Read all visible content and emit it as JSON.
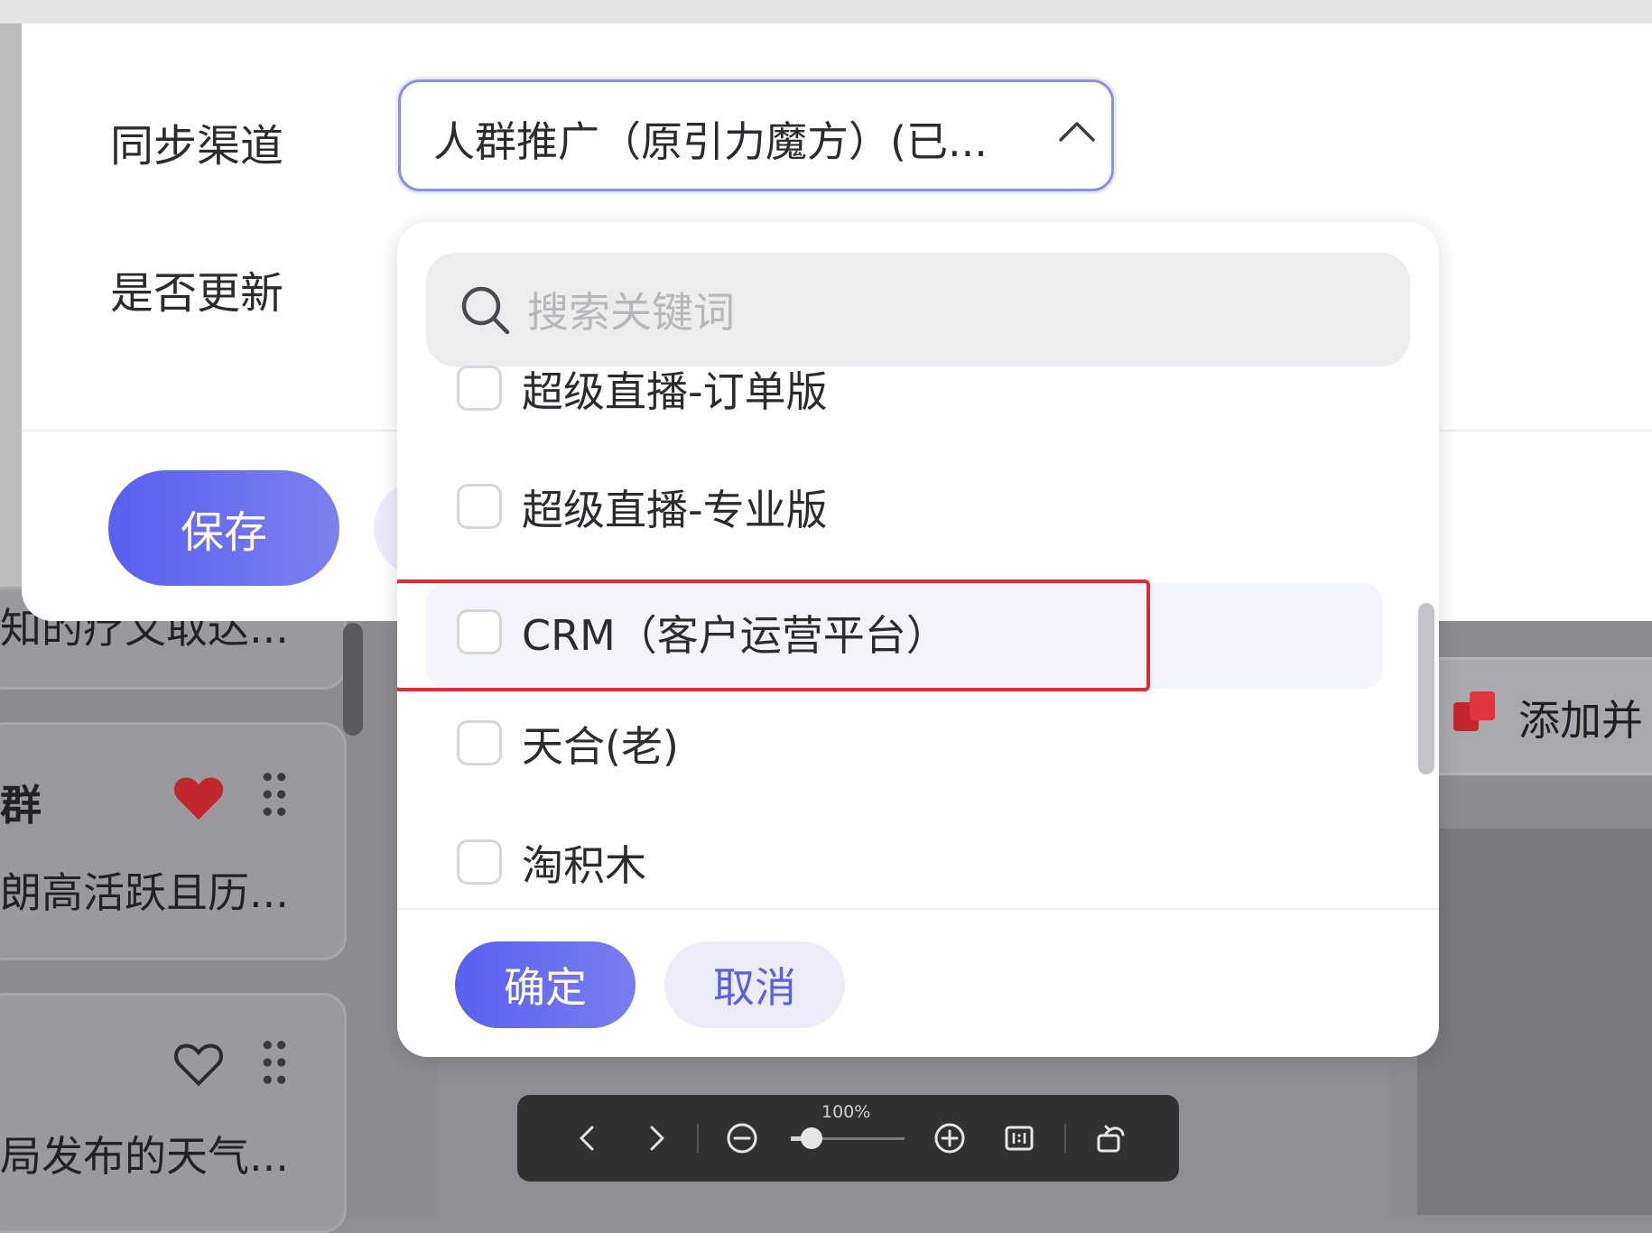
{
  "form": {
    "sync_channel_label": "同步渠道",
    "update_label": "是否更新",
    "selected_channel": "人群推广（原引力魔方）(已...",
    "save_label": "保存"
  },
  "dropdown": {
    "search_placeholder": "搜索关键词",
    "options": [
      {
        "label": "超级直播-订单版",
        "checked": false
      },
      {
        "label": "超级直播-专业版",
        "checked": false
      },
      {
        "label": "CRM（客户运营平台）",
        "checked": false,
        "highlighted": true
      },
      {
        "label": "天合(老)",
        "checked": false
      },
      {
        "label": "淘积木",
        "checked": false
      }
    ],
    "confirm_label": "确定",
    "cancel_label": "取消"
  },
  "background": {
    "card_partial_text": "知的疗又取达...",
    "card_1_title": "群",
    "card_1_desc": "朗高活跃且历...",
    "card_2_desc": "局发布的天气...",
    "right_button_label": "添加并"
  },
  "viewer_toolbar": {
    "zoom_label": "100%",
    "zoom_level": 0.18
  },
  "colors": {
    "accent": "#5b5ff0",
    "highlight_border": "#e02d2d",
    "heart_filled": "#c0282d"
  }
}
